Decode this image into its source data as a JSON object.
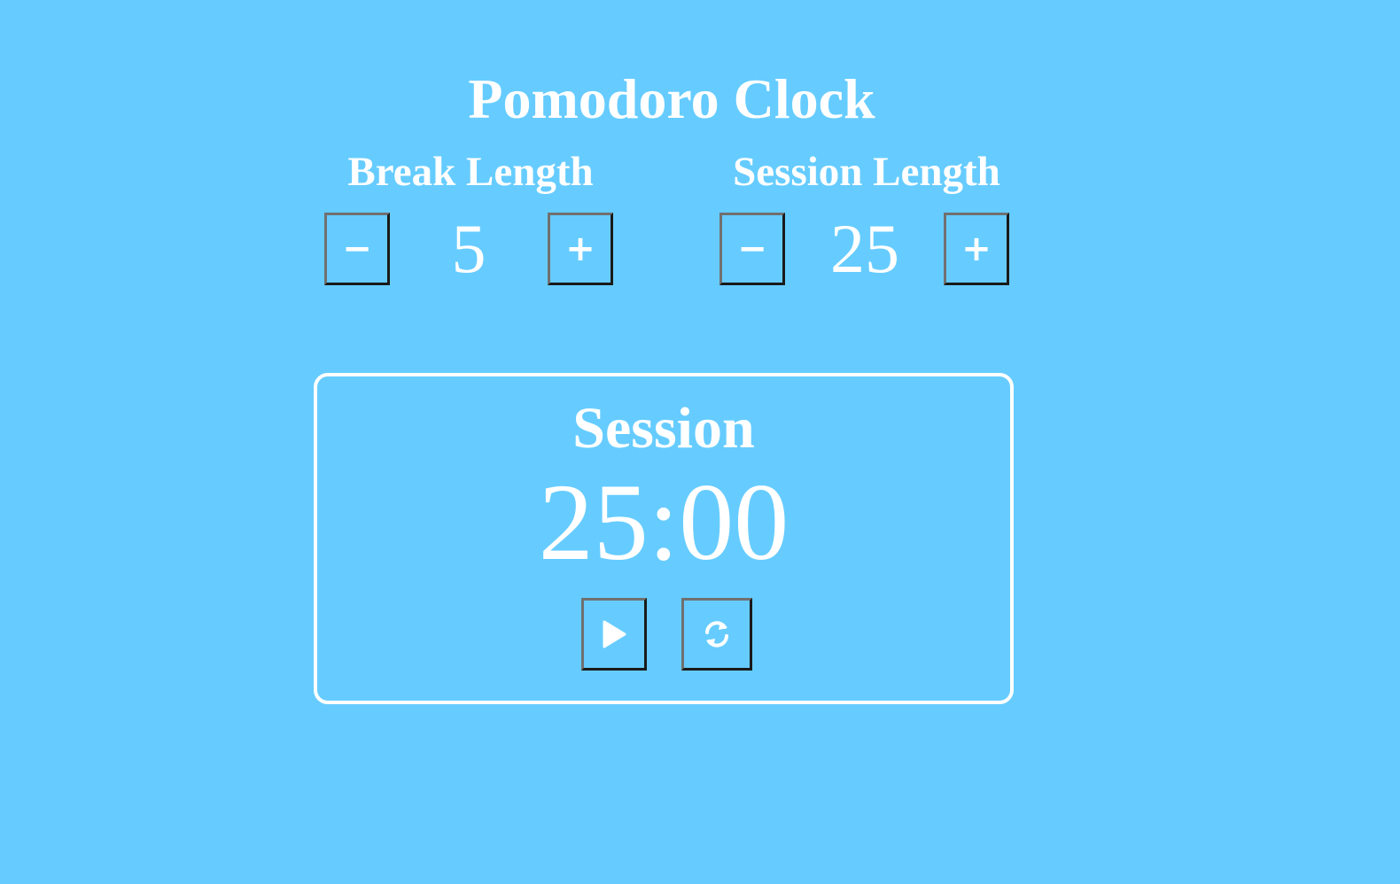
{
  "app": {
    "title": "Pomodoro Clock"
  },
  "break_control": {
    "label": "Break Length",
    "decrement_symbol": "−",
    "value": "5",
    "increment_symbol": "+"
  },
  "session_control": {
    "label": "Session Length",
    "decrement_symbol": "−",
    "value": "25",
    "increment_symbol": "+"
  },
  "timer": {
    "label": "Session",
    "display": "25:00",
    "play_icon": "play-icon",
    "reset_icon": "refresh-icon"
  },
  "colors": {
    "background": "#66ccff",
    "text": "#ffffff",
    "border": "#ffffff"
  }
}
